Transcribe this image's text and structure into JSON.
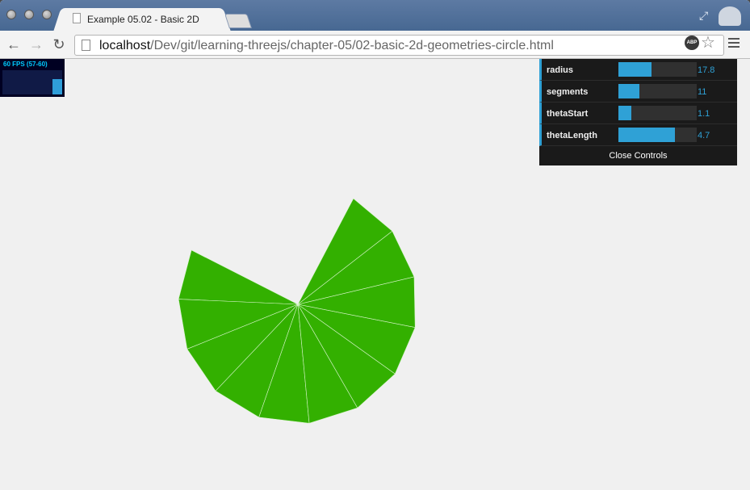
{
  "browser": {
    "tab_title": "Example 05.02 - Basic 2D",
    "url_host": "localhost",
    "url_path": "/Dev/git/learning-threejs/chapter-05/02-basic-2d-geometries-circle.html",
    "abp_label": "ABP"
  },
  "stats": {
    "fps_text": "60 FPS (57-60)"
  },
  "controls": [
    {
      "label": "radius",
      "value": "17.8",
      "fraction": 0.42
    },
    {
      "label": "segments",
      "value": "11",
      "fraction": 0.27
    },
    {
      "label": "thetaStart",
      "value": "1.1",
      "fraction": 0.16
    },
    {
      "label": "thetaLength",
      "value": "4.7",
      "fraction": 0.72
    }
  ],
  "close_label": "Close Controls",
  "colors": {
    "mesh": "#33b000",
    "accent": "#2fa1d6",
    "panel": "#1a1a1a"
  }
}
